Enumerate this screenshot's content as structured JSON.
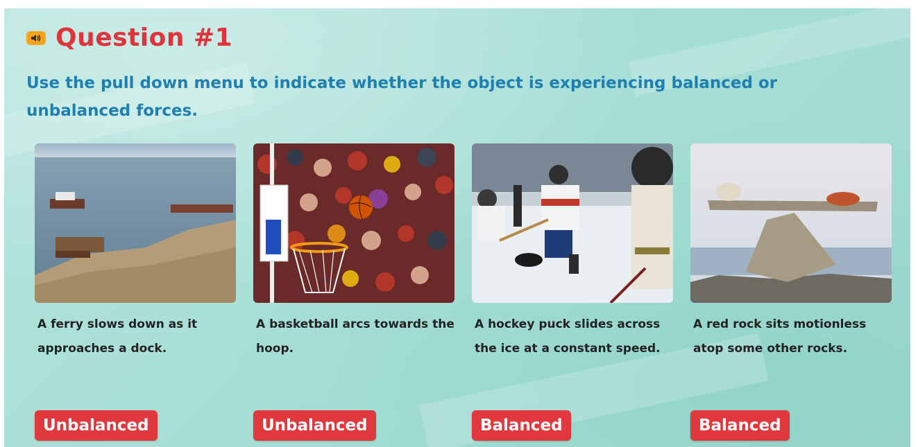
{
  "question": {
    "title": "Question #1",
    "instruction": "Use the pull down menu to indicate whether the object is experiencing balanced or unbalanced forces.",
    "audio_icon": "speaker-icon"
  },
  "items": [
    {
      "description": "A ferry slows down as it approaches a dock.",
      "answer": "Unbalanced",
      "image": "ferry-photo"
    },
    {
      "description": "A basketball arcs towards the hoop.",
      "answer": "Unbalanced",
      "image": "basketball-photo"
    },
    {
      "description": "A hockey puck slides across the ice at a constant speed.",
      "answer": "Balanced",
      "image": "hockey-photo"
    },
    {
      "description": "A red rock sits motionless atop some other rocks.",
      "answer": "Balanced",
      "image": "rocks-photo"
    }
  ],
  "colors": {
    "title": "#e0333b",
    "instruction": "#1f7fb0",
    "answer_bg": "#e0383d",
    "background": "#a7dfd6",
    "speaker": "#f5a31a"
  }
}
